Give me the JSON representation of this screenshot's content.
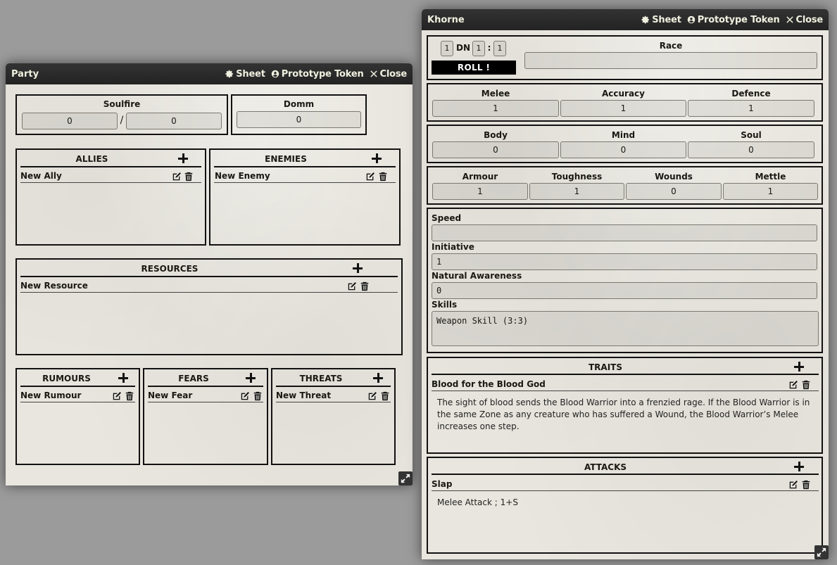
{
  "party_window": {
    "title": "Party",
    "header_buttons": {
      "sheet": "Sheet",
      "prototype_token": "Prototype Token",
      "close": "Close"
    },
    "soulfire": {
      "label": "Soulfire",
      "current": "0",
      "separator": "/",
      "max": "0"
    },
    "domm": {
      "label": "Domm",
      "value": "0"
    },
    "allies": {
      "title": "ALLIES",
      "items": [
        "New Ally"
      ]
    },
    "enemies": {
      "title": "ENEMIES",
      "items": [
        "New Enemy"
      ]
    },
    "resources": {
      "title": "RESOURCES",
      "items": [
        "New Resource"
      ]
    },
    "rumours": {
      "title": "RUMOURS",
      "items": [
        "New Rumour"
      ]
    },
    "fears": {
      "title": "FEARS",
      "items": [
        "New Fear"
      ]
    },
    "threats": {
      "title": "THREATS",
      "items": [
        "New Threat"
      ]
    }
  },
  "khorne_window": {
    "title": "Khorne",
    "header_buttons": {
      "sheet": "Sheet",
      "prototype_token": "Prototype Token",
      "close": "Close"
    },
    "roll": {
      "dice": "1",
      "dn_label": "DN",
      "dn_a": "1",
      "colon": ":",
      "dn_b": "1",
      "button": "ROLL !"
    },
    "race": {
      "label": "Race",
      "value": ""
    },
    "combat": [
      {
        "label": "Melee",
        "value": "1"
      },
      {
        "label": "Accuracy",
        "value": "1"
      },
      {
        "label": "Defence",
        "value": "1"
      }
    ],
    "attributes": [
      {
        "label": "Body",
        "value": "0"
      },
      {
        "label": "Mind",
        "value": "0"
      },
      {
        "label": "Soul",
        "value": "0"
      }
    ],
    "defence_stats": [
      {
        "label": "Armour",
        "value": "1"
      },
      {
        "label": "Toughness",
        "value": "1"
      },
      {
        "label": "Wounds",
        "value": "0"
      },
      {
        "label": "Mettle",
        "value": "1"
      }
    ],
    "speed": {
      "label": "Speed",
      "value": ""
    },
    "initiative": {
      "label": "Initiative",
      "value": "1"
    },
    "natural_awareness": {
      "label": "Natural Awareness",
      "value": "0"
    },
    "skills": {
      "label": "Skills",
      "value": "Weapon Skill (3:3)"
    },
    "traits": {
      "title": "TRAITS",
      "item_name": "Blood for the Blood God",
      "description": "The sight of blood sends the Blood Warrior into a frenzied rage. If the Blood Warrior is in the same Zone as any creature who has suffered a Wound, the Blood Warrior’s Melee increases one step."
    },
    "attacks": {
      "title": "ATTACKS",
      "item_name": "Slap",
      "description": "Melee Attack ; 1+S"
    }
  },
  "icons": {
    "sheet": "gear-icon",
    "prototype_token": "user-circle-icon",
    "close": "close-icon",
    "add": "plus-icon",
    "edit": "edit-icon",
    "delete": "trash-icon",
    "resize": "resize-icon"
  }
}
